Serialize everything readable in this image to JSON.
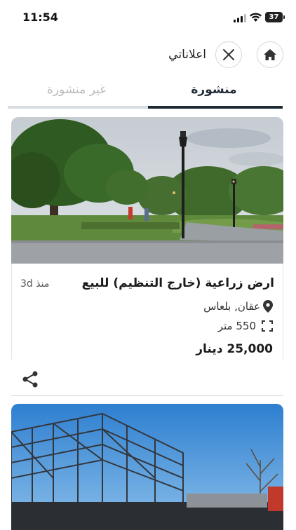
{
  "status_bar": {
    "time": "11:54",
    "battery": "37"
  },
  "header": {
    "title": "اعلاناتي",
    "home_icon": "home-icon",
    "close_icon": "close-icon"
  },
  "tabs": [
    {
      "label": "منشورة",
      "active": true
    },
    {
      "label": "غير منشورة",
      "active": false
    }
  ],
  "listing": {
    "title": "ارض زراعية (خارج التنظيم) للبيع",
    "age": "منذ 3d",
    "location": "عقان, بلعاس",
    "area": "550 متر",
    "price": "25,000 دينار"
  },
  "colors": {
    "accent": "#1d2a34",
    "inactive_tab": "#b8b8b8",
    "border": "#e3e3e3"
  }
}
